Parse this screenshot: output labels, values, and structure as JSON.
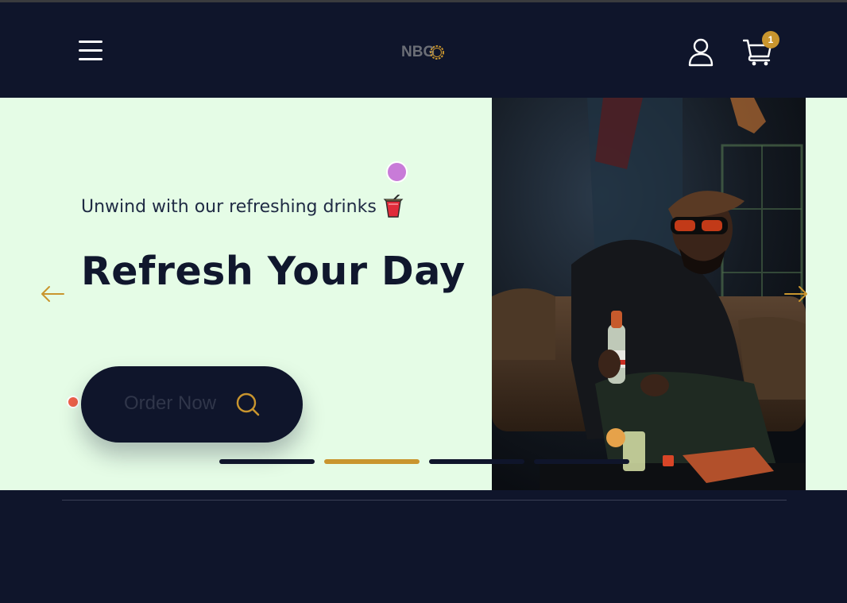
{
  "navbar": {
    "logo_text": "NBG",
    "cart_count": "1",
    "icons": [
      "hamburger-icon",
      "user-icon",
      "cart-icon"
    ]
  },
  "hero": {
    "subtitle": "Unwind with our refreshing drinks",
    "headline": "Refresh Your Day",
    "cta_label": "Order Now",
    "carousel": {
      "slide_count": 4,
      "active_index": 1
    },
    "colors": {
      "background": "#e5fce6",
      "accent": "#c9952e",
      "navy": "#0f152b",
      "purple_dot": "#c87bd8",
      "red_dot": "#f0604a"
    }
  }
}
